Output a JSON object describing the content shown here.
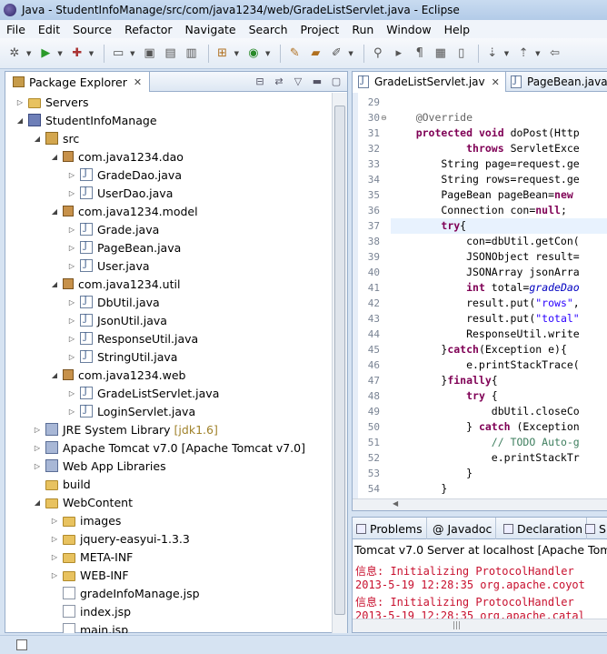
{
  "window": {
    "title": "Java - StudentInfoManage/src/com/java1234/web/GradeListServlet.java - Eclipse"
  },
  "menu": [
    "File",
    "Edit",
    "Source",
    "Refactor",
    "Navigate",
    "Search",
    "Project",
    "Run",
    "Window",
    "Help"
  ],
  "package_explorer": {
    "title": "Package Explorer",
    "tree": [
      {
        "label": "Servers",
        "icon": "folder-icon",
        "depth": 0,
        "arrow": "collapsed"
      },
      {
        "label": "StudentInfoManage",
        "icon": "project-icon",
        "depth": 0,
        "arrow": "expanded"
      },
      {
        "label": "src",
        "icon": "source-folder-icon",
        "depth": 1,
        "arrow": "expanded"
      },
      {
        "label": "com.java1234.dao",
        "icon": "package-icon",
        "depth": 2,
        "arrow": "expanded"
      },
      {
        "label": "GradeDao.java",
        "icon": "java-file-icon",
        "depth": 3,
        "arrow": "collapsed"
      },
      {
        "label": "UserDao.java",
        "icon": "java-file-icon",
        "depth": 3,
        "arrow": "collapsed"
      },
      {
        "label": "com.java1234.model",
        "icon": "package-icon",
        "depth": 2,
        "arrow": "expanded"
      },
      {
        "label": "Grade.java",
        "icon": "java-file-icon",
        "depth": 3,
        "arrow": "collapsed"
      },
      {
        "label": "PageBean.java",
        "icon": "java-file-icon",
        "depth": 3,
        "arrow": "collapsed"
      },
      {
        "label": "User.java",
        "icon": "java-file-icon",
        "depth": 3,
        "arrow": "collapsed"
      },
      {
        "label": "com.java1234.util",
        "icon": "package-icon",
        "depth": 2,
        "arrow": "expanded"
      },
      {
        "label": "DbUtil.java",
        "icon": "java-file-icon",
        "depth": 3,
        "arrow": "collapsed"
      },
      {
        "label": "JsonUtil.java",
        "icon": "java-file-icon",
        "depth": 3,
        "arrow": "collapsed"
      },
      {
        "label": "ResponseUtil.java",
        "icon": "java-file-icon",
        "depth": 3,
        "arrow": "collapsed"
      },
      {
        "label": "StringUtil.java",
        "icon": "java-file-icon",
        "depth": 3,
        "arrow": "collapsed"
      },
      {
        "label": "com.java1234.web",
        "icon": "package-icon",
        "depth": 2,
        "arrow": "expanded"
      },
      {
        "label": "GradeListServlet.java",
        "icon": "java-file-icon",
        "depth": 3,
        "arrow": "collapsed"
      },
      {
        "label": "LoginServlet.java",
        "icon": "java-file-icon",
        "depth": 3,
        "arrow": "collapsed"
      },
      {
        "label": "JRE System Library",
        "suffix": "[jdk1.6]",
        "icon": "library-icon",
        "depth": 1,
        "arrow": "collapsed"
      },
      {
        "label": "Apache Tomcat v7.0 [Apache Tomcat v7.0]",
        "icon": "library-icon",
        "depth": 1,
        "arrow": "collapsed"
      },
      {
        "label": "Web App Libraries",
        "icon": "library-icon",
        "depth": 1,
        "arrow": "collapsed"
      },
      {
        "label": "build",
        "icon": "folder-icon",
        "depth": 1,
        "arrow": "none"
      },
      {
        "label": "WebContent",
        "icon": "folder-icon",
        "depth": 1,
        "arrow": "expanded"
      },
      {
        "label": "images",
        "icon": "folder-icon",
        "depth": 2,
        "arrow": "collapsed"
      },
      {
        "label": "jquery-easyui-1.3.3",
        "icon": "folder-icon",
        "depth": 2,
        "arrow": "collapsed"
      },
      {
        "label": "META-INF",
        "icon": "folder-icon",
        "depth": 2,
        "arrow": "collapsed"
      },
      {
        "label": "WEB-INF",
        "icon": "folder-icon",
        "depth": 2,
        "arrow": "collapsed"
      },
      {
        "label": "gradeInfoManage.jsp",
        "icon": "jsp-file-icon",
        "depth": 2,
        "arrow": "none"
      },
      {
        "label": "index.jsp",
        "icon": "jsp-file-icon",
        "depth": 2,
        "arrow": "none"
      },
      {
        "label": "main.jsp",
        "icon": "jsp-file-icon",
        "depth": 2,
        "arrow": "none"
      }
    ]
  },
  "editor": {
    "tabs": [
      "GradeListServlet.jav",
      "PageBean.java"
    ],
    "lines": [
      {
        "n": "29",
        "segs": []
      },
      {
        "n": "30",
        "segs": [
          [
            "    ",
            ""
          ],
          [
            "@Override",
            "#646464"
          ]
        ],
        "fold": "⊖"
      },
      {
        "n": "31",
        "segs": [
          [
            "    ",
            ""
          ],
          [
            "protected void",
            "#7f0055"
          ],
          [
            " doPost(Http",
            ""
          ]
        ]
      },
      {
        "n": "32",
        "segs": [
          [
            "            ",
            ""
          ],
          [
            "throws",
            "#7f0055"
          ],
          [
            " ServletExce",
            ""
          ]
        ]
      },
      {
        "n": "33",
        "segs": [
          [
            "        String page=request.ge",
            ""
          ]
        ]
      },
      {
        "n": "34",
        "segs": [
          [
            "        String rows=request.ge",
            ""
          ]
        ]
      },
      {
        "n": "35",
        "segs": [
          [
            "        PageBean pageBean=",
            ""
          ],
          [
            "new",
            "#7f0055"
          ]
        ]
      },
      {
        "n": "36",
        "segs": [
          [
            "        Connection con=",
            ""
          ],
          [
            "null",
            "#7f0055"
          ],
          [
            ";",
            ""
          ]
        ]
      },
      {
        "n": "37",
        "segs": [
          [
            "        ",
            ""
          ],
          [
            "try",
            "#7f0055"
          ],
          [
            "{",
            ""
          ]
        ],
        "current": true
      },
      {
        "n": "38",
        "segs": [
          [
            "            con=dbUtil.getCon(",
            ""
          ]
        ]
      },
      {
        "n": "39",
        "segs": [
          [
            "            JSONObject result=",
            ""
          ]
        ]
      },
      {
        "n": "40",
        "segs": [
          [
            "            JSONArray jsonArra",
            ""
          ]
        ]
      },
      {
        "n": "41",
        "segs": [
          [
            "            ",
            ""
          ],
          [
            "int",
            "#7f0055"
          ],
          [
            " total=",
            ""
          ],
          [
            "gradeDao",
            "#0000c0"
          ]
        ]
      },
      {
        "n": "42",
        "segs": [
          [
            "            result.put(",
            ""
          ],
          [
            "\"rows\"",
            "#2a00ff"
          ],
          [
            ",",
            ""
          ]
        ]
      },
      {
        "n": "43",
        "segs": [
          [
            "            result.put(",
            ""
          ],
          [
            "\"total\"",
            "#2a00ff"
          ]
        ]
      },
      {
        "n": "44",
        "segs": [
          [
            "            ResponseUtil.",
            ""
          ],
          [
            "write",
            ""
          ]
        ]
      },
      {
        "n": "45",
        "segs": [
          [
            "        }",
            ""
          ],
          [
            "catch",
            "#7f0055"
          ],
          [
            "(Exception e){",
            ""
          ]
        ]
      },
      {
        "n": "46",
        "segs": [
          [
            "            e.printStackTrace(",
            ""
          ]
        ]
      },
      {
        "n": "47",
        "segs": [
          [
            "        }",
            ""
          ],
          [
            "finally",
            "#7f0055"
          ],
          [
            "{",
            ""
          ]
        ]
      },
      {
        "n": "48",
        "segs": [
          [
            "            ",
            ""
          ],
          [
            "try",
            "#7f0055"
          ],
          [
            " {",
            ""
          ]
        ]
      },
      {
        "n": "49",
        "segs": [
          [
            "                dbUtil.closeCo",
            ""
          ]
        ]
      },
      {
        "n": "50",
        "segs": [
          [
            "            } ",
            ""
          ],
          [
            "catch",
            "#7f0055"
          ],
          [
            " (Exception",
            ""
          ]
        ]
      },
      {
        "n": "51",
        "segs": [
          [
            "                ",
            ""
          ],
          [
            "// TODO Auto-g",
            "#3f7f5f"
          ]
        ]
      },
      {
        "n": "52",
        "segs": [
          [
            "                e.printStackTr",
            ""
          ]
        ]
      },
      {
        "n": "53",
        "segs": [
          [
            "            }",
            ""
          ]
        ]
      },
      {
        "n": "54",
        "segs": [
          [
            "        }",
            ""
          ]
        ]
      }
    ]
  },
  "console": {
    "tabs": [
      "Problems",
      "Javadoc",
      "Declaration",
      "S"
    ],
    "title": "Tomcat v7.0 Server at localhost [Apache Tomcat",
    "lines": [
      "信息: Initializing ProtocolHandler",
      "2013-5-19 12:28:35 org.apache.coyot",
      "信息: Initializing ProtocolHandler",
      "2013-5-19 12:28:35 org.apache.catal"
    ],
    "grip": "|||"
  },
  "colors": {
    "keyword": "#7f0055",
    "string": "#2a00ff",
    "field": "#0000c0",
    "comment": "#3f7f5f",
    "console_text": "#c8102e"
  }
}
